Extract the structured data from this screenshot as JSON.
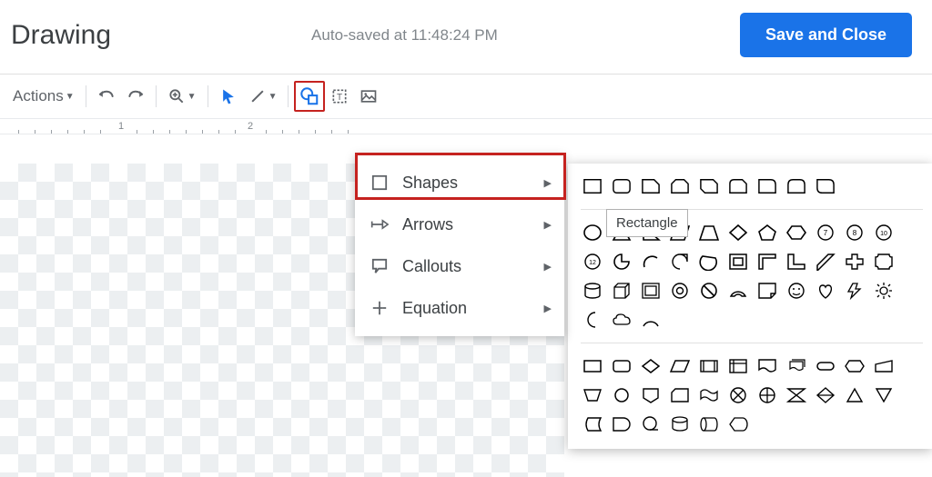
{
  "header": {
    "title": "Drawing",
    "status": "Auto-saved at 11:48:24 PM",
    "save_button": "Save and Close"
  },
  "toolbar": {
    "actions": "Actions"
  },
  "ruler": {
    "marks": [
      "1",
      "2"
    ]
  },
  "menu": {
    "shapes": "Shapes",
    "arrows": "Arrows",
    "callouts": "Callouts",
    "equation": "Equation"
  },
  "tooltip": "Rectangle"
}
